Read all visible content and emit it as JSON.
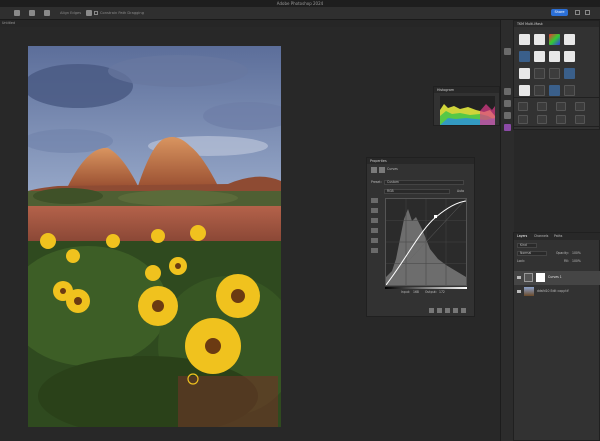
{
  "app": {
    "title": "Adobe Photoshop 2024"
  },
  "options_bar": {
    "item1": "Align Edges",
    "constrain": "Constrain Path Dragging",
    "share_label": "Share"
  },
  "document": {
    "tab_label": "Untitled"
  },
  "histogram": {
    "title": "Histogram"
  },
  "properties": {
    "title": "Properties",
    "subtitle": "Curves",
    "preset_label": "Preset:",
    "preset_value": "Custom",
    "channel_value": "RGB",
    "auto_label": "Auto",
    "input_label": "Input:",
    "input_value": "168",
    "output_label": "Output:",
    "output_value": "172"
  },
  "tkm_panel": {
    "title": "TKM Multi-Mask"
  },
  "layers": {
    "tabs": [
      "Layers",
      "Channels",
      "Paths"
    ],
    "kind_label": "Kind",
    "blend_mode": "Normal",
    "opacity_label": "Opacity:",
    "opacity_value": "100%",
    "lock_label": "Lock:",
    "fill_label": "Fill:",
    "fill_value": "100%",
    "items": [
      {
        "name": "Curves 1"
      },
      {
        "name": "ddsfd10 Edit copy.tif"
      }
    ]
  },
  "colors": {
    "accent": "#2b6fd6",
    "panel_bg": "#323232",
    "canvas_bg": "#282828"
  }
}
